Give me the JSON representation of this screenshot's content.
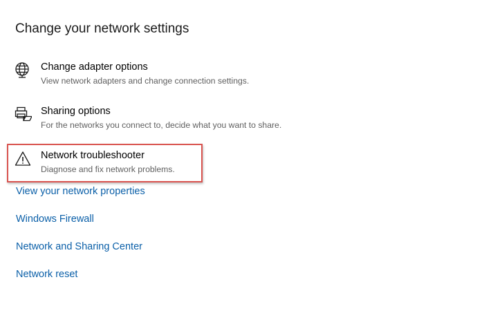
{
  "page": {
    "title": "Change your network settings"
  },
  "settings_items": [
    {
      "title": "Change adapter options",
      "description": "View network adapters and change connection settings.",
      "icon": "globe-network-icon"
    },
    {
      "title": "Sharing options",
      "description": "For the networks you connect to, decide what you want to share.",
      "icon": "sharing-icon"
    },
    {
      "title": "Network troubleshooter",
      "description": "Diagnose and fix network problems.",
      "icon": "warning-icon"
    }
  ],
  "highlight": {
    "target": "Network troubleshooter",
    "color": "#d9534f"
  },
  "links": [
    {
      "label": "View your network properties"
    },
    {
      "label": "Windows Firewall"
    },
    {
      "label": "Network and Sharing Center"
    },
    {
      "label": "Network reset"
    }
  ],
  "colors": {
    "link": "#0a5fa8",
    "description_text": "#5f5f5f",
    "title_text": "#1a1a1a"
  }
}
